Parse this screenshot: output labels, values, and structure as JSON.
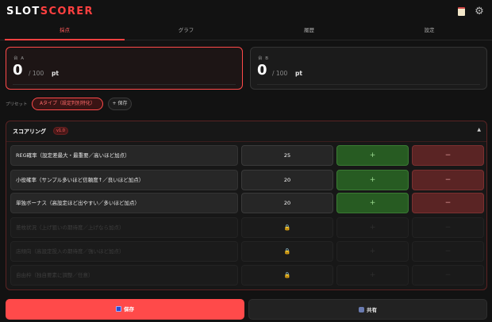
{
  "app": {
    "logo_part1": "SLOT",
    "logo_part2": "SCORER"
  },
  "header_icons": {
    "left": "clipboard-icon",
    "right": "gear-icon"
  },
  "tabs": [
    {
      "label": "採点",
      "active": true
    },
    {
      "label": "グラフ",
      "active": false
    },
    {
      "label": "履歴",
      "active": false
    },
    {
      "label": "設定",
      "active": false
    }
  ],
  "scores": [
    {
      "label": "台 A",
      "value": "0",
      "max": "/ 100",
      "unit": "pt",
      "selected": true
    },
    {
      "label": "台 B",
      "value": "0",
      "max": "/ 100",
      "unit": "pt",
      "selected": false
    }
  ],
  "presets": {
    "label": "プリセット",
    "active_preset": "Aタイプ（設定判別特化）",
    "save_label": "+ 保存"
  },
  "scoring": {
    "title": "スコアリング",
    "version": "v1.0",
    "collapse_icon": "▲",
    "rows": [
      {
        "label": "REG確率（設定差最大・最重要／高いほど加点）",
        "value": "25",
        "plus": "+",
        "minus": "−",
        "locked": false
      },
      {
        "label": "小役確率（サンプル多いほど信頼度↑／良いほど加点）",
        "value": "20",
        "plus": "+",
        "minus": "−",
        "locked": false
      },
      {
        "label": "単独ボーナス（高設定ほど出やすい／多いほど加点）",
        "value": "20",
        "plus": "+",
        "minus": "−",
        "locked": false
      },
      {
        "label": "差枚状況（上げ狙いの期待度／上げなら加点）",
        "value": "🔒",
        "plus": "+",
        "minus": "−",
        "locked": true
      },
      {
        "label": "店傾向（高設定投入の期待度／強いほど加点）",
        "value": "🔒",
        "plus": "+",
        "minus": "−",
        "locked": true
      },
      {
        "label": "自由枠（独自要素に調整／任意）",
        "value": "🔒",
        "plus": "+",
        "minus": "−",
        "locked": true
      }
    ]
  },
  "actions": {
    "save_label": "保存",
    "share_label": "共有"
  },
  "colors": {
    "accent": "#ff4a4a",
    "plus_bg": "#275b22",
    "minus_bg": "#5a2424"
  }
}
